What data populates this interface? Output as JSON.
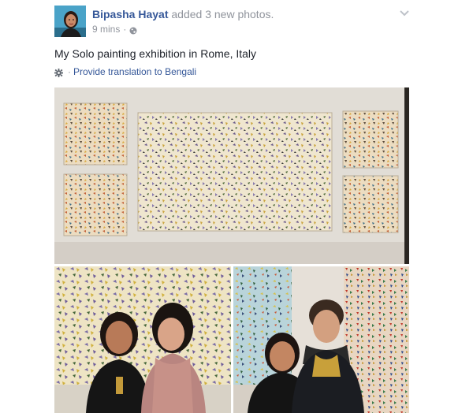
{
  "post": {
    "author_name": "Bipasha Hayat",
    "action_text": "added 3 new photos.",
    "timestamp": "9 mins",
    "separator": "·",
    "privacy_icon": "globe-icon",
    "options_icon": "chevron-down-icon",
    "text": "My Solo painting exhibition in Rome, Italy",
    "translation": {
      "icon": "gear-icon",
      "separator": "·",
      "link_label": "Provide translation to Bengali"
    }
  },
  "photos": [
    {
      "name": "gallery-wall-paintings",
      "description_icon": "photo"
    },
    {
      "name": "two-women-in-front-of-painting",
      "description_icon": "photo"
    },
    {
      "name": "woman-and-man-in-gallery",
      "description_icon": "photo"
    }
  ],
  "colors": {
    "link": "#365899",
    "meta": "#90949c",
    "text": "#1d2129"
  }
}
